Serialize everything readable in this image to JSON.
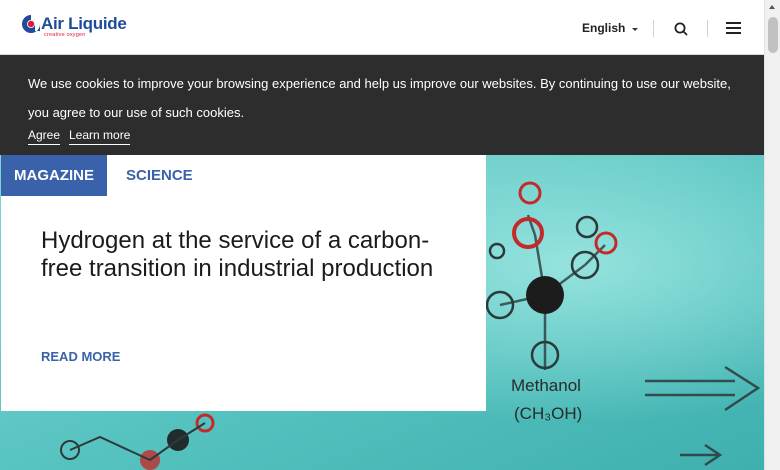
{
  "header": {
    "logo_text": "Air Liquide",
    "logo_tagline": "creative oxygen",
    "language": "English",
    "icons": {
      "search": "search-icon",
      "menu": "hamburger-menu-icon",
      "language_caret": "caret-down-icon"
    }
  },
  "cookie_banner": {
    "message": "We use cookies to improve your browsing experience and help us improve our websites. By continuing to use our website, you agree to our use of such cookies.",
    "agree_label": "Agree",
    "learn_more_label": "Learn more"
  },
  "hero": {
    "category_primary": "MAGAZINE",
    "category_secondary": "SCIENCE",
    "headline": "Hydrogen at the service of a carbon-free transition in industrial production",
    "read_more_label": "READ MORE",
    "image_labels": {
      "methanol": "Methanol",
      "formula": "(CH₃OH)"
    }
  },
  "colors": {
    "brand_blue": "#3a62aa",
    "logo_red": "#e0193a",
    "banner_bg": "#2d2d2d",
    "hero_bg": "#5ec6c4"
  }
}
